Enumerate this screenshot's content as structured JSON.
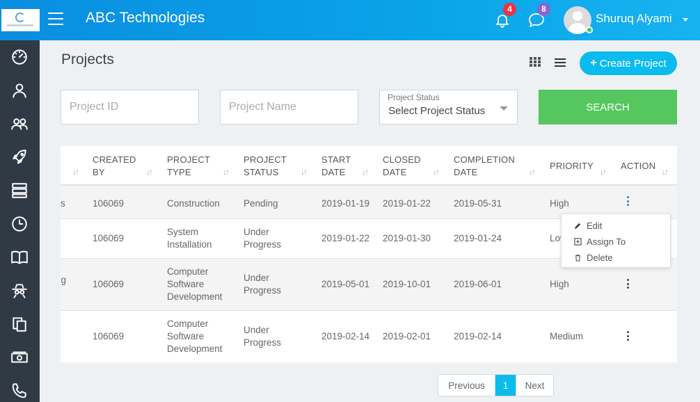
{
  "header": {
    "brand": "ABC Technologies",
    "notifications_count": "4",
    "messages_count": "8",
    "username": "Shuruq Alyami"
  },
  "sidebar": {
    "items": [
      {
        "icon": "dashboard-icon"
      },
      {
        "icon": "user-icon"
      },
      {
        "icon": "users-icon"
      },
      {
        "icon": "rocket-icon"
      },
      {
        "icon": "server-icon"
      },
      {
        "icon": "clock-icon"
      },
      {
        "icon": "book-icon"
      },
      {
        "icon": "spy-icon"
      },
      {
        "icon": "copy-icon"
      },
      {
        "icon": "money-icon"
      },
      {
        "icon": "phone-icon"
      }
    ]
  },
  "page": {
    "title": "Projects",
    "create_label": "Create Project"
  },
  "filters": {
    "project_id_placeholder": "Project ID",
    "project_name_placeholder": "Project Name",
    "status_label": "Project Status",
    "status_value": "Select Project Status",
    "search_label": "SEARCH"
  },
  "table": {
    "headers": [
      {
        "line1": "CREATED",
        "line2": "BY"
      },
      {
        "line1": "PROJECT",
        "line2": "TYPE"
      },
      {
        "line1": "PROJECT",
        "line2": "STATUS"
      },
      {
        "line1": "START",
        "line2": "DATE"
      },
      {
        "line1": "CLOSED",
        "line2": "DATE"
      },
      {
        "line1": "COMPLETION",
        "line2": "DATE"
      },
      {
        "line1": "PRIORITY",
        "line2": ""
      },
      {
        "line1": "ACTION",
        "line2": ""
      }
    ],
    "rows": [
      {
        "partial": "s",
        "created_by": "106069",
        "type": [
          "Construction"
        ],
        "status": [
          "Pending"
        ],
        "start": "2019-01-19",
        "closed": "2019-01-22",
        "completion": "2019-05-31",
        "priority": "High"
      },
      {
        "partial": "",
        "created_by": "106069",
        "type": [
          "System",
          "Installation"
        ],
        "status": [
          "Under",
          "Progress"
        ],
        "start": "2019-01-22",
        "closed": "2019-01-30",
        "completion": "2019-01-24",
        "priority": "Low"
      },
      {
        "partial": "ing",
        "created_by": "106069",
        "type": [
          "Computer",
          "Software",
          "Development"
        ],
        "status": [
          "Under",
          "Progress"
        ],
        "start": "2019-05-01",
        "closed": "2019-10-01",
        "completion": "2019-06-01",
        "priority": "High"
      },
      {
        "partial": "",
        "created_by": "106069",
        "type": [
          "Computer",
          "Software",
          "Development"
        ],
        "status": [
          "Under",
          "Progress"
        ],
        "start": "2019-02-14",
        "closed": "2019-02-01",
        "completion": "2019-02-14",
        "priority": "Medium"
      }
    ]
  },
  "action_menu": {
    "edit": "Edit",
    "assign": "Assign To",
    "delete": "Delete"
  },
  "pagination": {
    "previous": "Previous",
    "current": "1",
    "next": "Next"
  }
}
